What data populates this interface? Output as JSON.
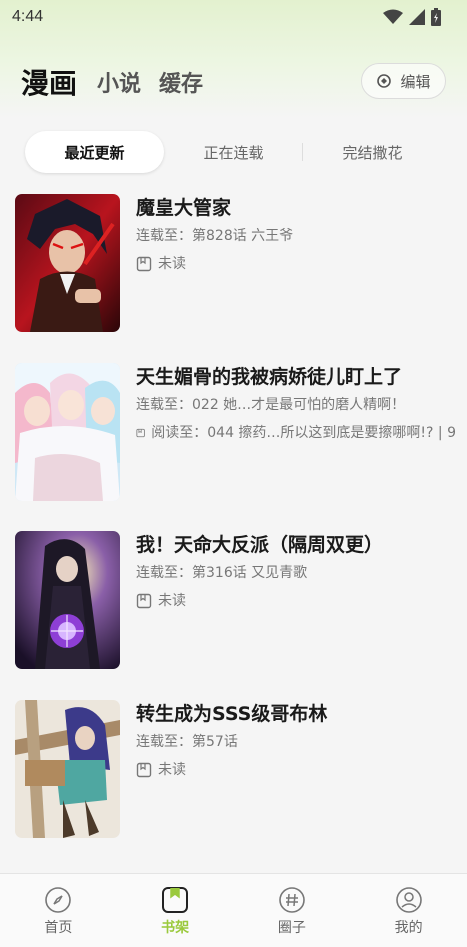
{
  "status_bar": {
    "time": "4:44"
  },
  "header": {
    "tabs": [
      {
        "label": "漫画",
        "active": true
      },
      {
        "label": "小说",
        "active": false
      },
      {
        "label": "缓存",
        "active": false
      }
    ],
    "edit_label": "编辑"
  },
  "filter": {
    "tabs": [
      {
        "label": "最近更新",
        "active": true
      },
      {
        "label": "正在连载",
        "active": false
      },
      {
        "label": "完结撒花",
        "active": false
      }
    ]
  },
  "comics": [
    {
      "title": "魔皇大管家",
      "latest": "连载至：第828话 六王爷",
      "read": "未读"
    },
    {
      "title": "天生媚骨的我被病娇徒儿盯上了",
      "latest": "连载至：022 她…才是最可怕的磨人精啊！",
      "read": "阅读至：044 擦药…所以这到底是要擦哪啊!? | 9"
    },
    {
      "title": "我！天命大反派（隔周双更）",
      "latest": "连载至：第316话 又见青歌",
      "read": "未读"
    },
    {
      "title": "转生成为SSS级哥布林",
      "latest": "连载至：第57话",
      "read": "未读"
    }
  ],
  "bottom_nav": [
    {
      "label": "首页",
      "active": false
    },
    {
      "label": "书架",
      "active": true
    },
    {
      "label": "圈子",
      "active": false
    },
    {
      "label": "我的",
      "active": false
    }
  ],
  "colors": {
    "accent": "#9ac93c",
    "header_gradient": "#e3f1cf"
  }
}
